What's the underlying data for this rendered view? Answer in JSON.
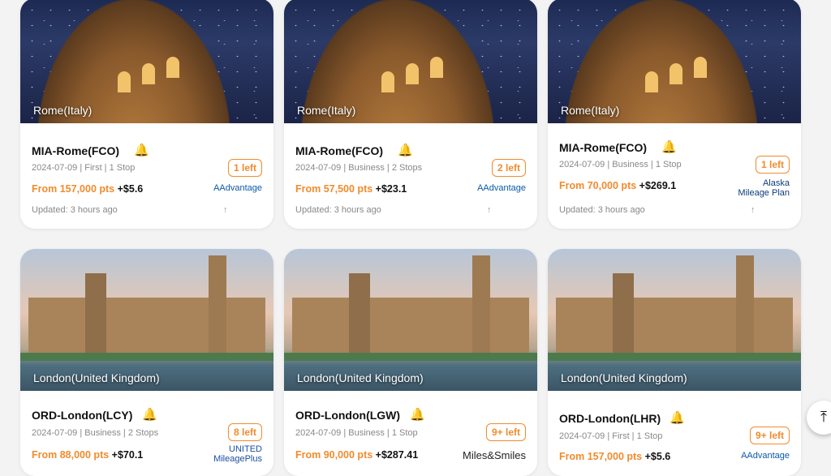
{
  "cards": [
    {
      "caption": "Rome(Italy)",
      "route": "MIA-Rome(FCO)",
      "meta": "2024-07-09 | First | 1 Stop",
      "left": "1 left",
      "pts": "From 157,000 pts",
      "fee": "+$5.6",
      "logo": "AAdvantage",
      "updated": "Updated: 3 hours ago"
    },
    {
      "caption": "Rome(Italy)",
      "route": "MIA-Rome(FCO)",
      "meta": "2024-07-09 | Business | 2 Stops",
      "left": "2 left",
      "pts": "From 57,500 pts",
      "fee": "+$23.1",
      "logo": "AAdvantage",
      "updated": "Updated: 3 hours ago"
    },
    {
      "caption": "Rome(Italy)",
      "route": "MIA-Rome(FCO)",
      "meta": "2024-07-09 | Business | 1 Stop",
      "left": "1 left",
      "pts": "From 70,000 pts",
      "fee": "+$269.1",
      "logo": "Alaska Mileage Plan",
      "updated": "Updated: 3 hours ago"
    },
    {
      "caption": "London(United Kingdom)",
      "route": "ORD-London(LCY)",
      "meta": "2024-07-09 | Business | 2 Stops",
      "left": "8 left",
      "pts": "From 88,000 pts",
      "fee": "+$70.1",
      "logo": "UNITED MileagePlus"
    },
    {
      "caption": "London(United Kingdom)",
      "route": "ORD-London(LGW)",
      "meta": "2024-07-09 | Business | 1 Stop",
      "left": "9+ left",
      "pts": "From 90,000 pts",
      "fee": "+$287.41",
      "logo": "Miles&Smiles"
    },
    {
      "caption": "London(United Kingdom)",
      "route": "ORD-London(LHR)",
      "meta": "2024-07-09 | First | 1 Stop",
      "left": "9+ left",
      "pts": "From 157,000 pts",
      "fee": "+$5.6",
      "logo": "AAdvantage"
    }
  ],
  "icons": {
    "bell": "bell-icon",
    "arrow": "arrow-up-icon",
    "scrolltop": "scroll-top-icon"
  },
  "colors": {
    "accent": "#f28b2c"
  }
}
